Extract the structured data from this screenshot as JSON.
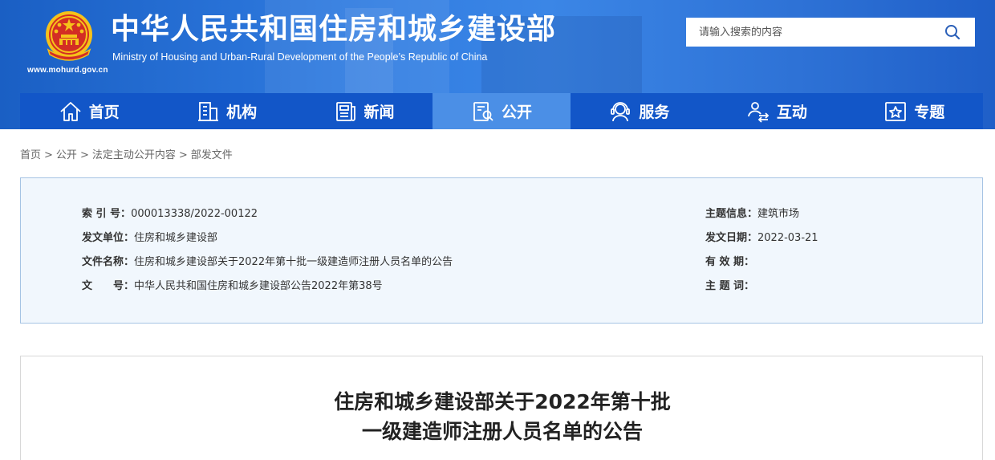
{
  "header": {
    "site_title": "中华人民共和国住房和城乡建设部",
    "site_subtitle": "Ministry of Housing and Urban-Rural Development of the People’s Republic of China",
    "site_url": "www.mohurd.gov.cn",
    "emblem_icon": "national-emblem-icon",
    "search": {
      "placeholder": "请输入搜索的内容",
      "icon": "search-icon"
    },
    "colors": {
      "header_bg": "#2f7be0",
      "nav_bg": "#1256c8",
      "nav_active": "#4b8fe6"
    }
  },
  "nav": {
    "items": [
      {
        "label": "首页",
        "icon": "home-icon",
        "active": false
      },
      {
        "label": "机构",
        "icon": "building-icon",
        "active": false
      },
      {
        "label": "新闻",
        "icon": "newspaper-icon",
        "active": false
      },
      {
        "label": "公开",
        "icon": "document-search-icon",
        "active": true
      },
      {
        "label": "服务",
        "icon": "customer-service-icon",
        "active": false
      },
      {
        "label": "互动",
        "icon": "interaction-icon",
        "active": false
      },
      {
        "label": "专题",
        "icon": "star-box-icon",
        "active": false
      }
    ]
  },
  "breadcrumb": {
    "items": [
      "首页",
      "公开",
      "法定主动公开内容",
      "部发文件"
    ],
    "separator": ">"
  },
  "info": {
    "index_label": "索 引 号：",
    "index_value": "000013338/2022-00122",
    "issuer_label": "发文单位：",
    "issuer_value": "住房和城乡建设部",
    "docname_label": "文件名称：",
    "docname_value": "住房和城乡建设部关于2022年第十批一级建造师注册人员名单的公告",
    "docno_label": "文　　号：",
    "docno_value": "中华人民共和国住房和城乡建设部公告2022年第38号",
    "topic_label": "主题信息：",
    "topic_value": "建筑市场",
    "date_label": "发文日期：",
    "date_value": "2022-03-21",
    "validity_label": "有 效 期：",
    "validity_value": "",
    "keywords_label": "主 题 词：",
    "keywords_value": ""
  },
  "article": {
    "title_line1": "住房和城乡建设部关于2022年第十批",
    "title_line2": "一级建造师注册人员名单的公告"
  }
}
